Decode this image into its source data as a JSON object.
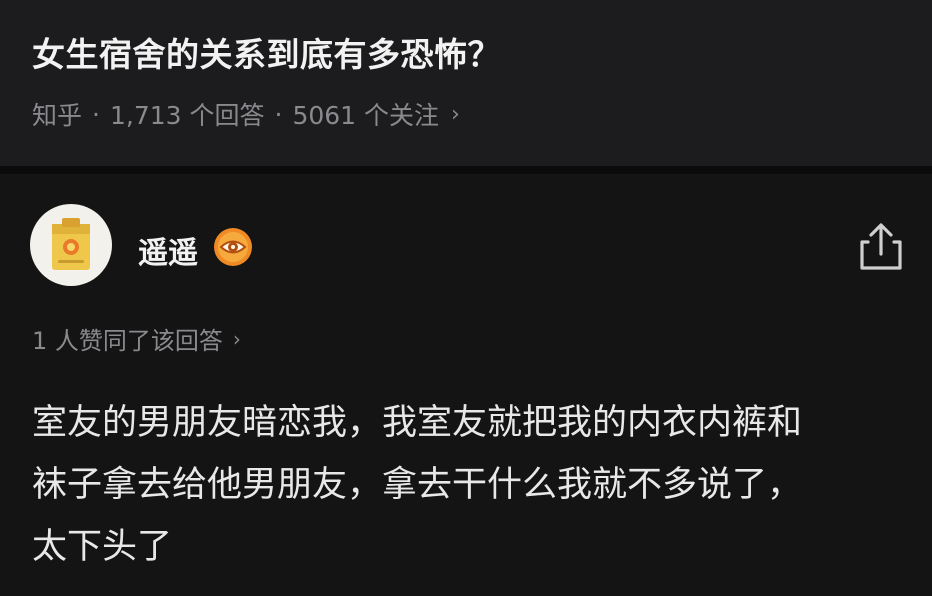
{
  "question": {
    "title": "女生宿舍的关系到底有多恐怖？",
    "source": "知乎",
    "answers_count": "1,713 个回答",
    "followers_count": "5061 个关注",
    "separator": "·",
    "chevron": "›"
  },
  "answer": {
    "author": {
      "name": "遥遥",
      "avatar_icon": "sticky-note-avatar",
      "badge_icon": "eye-badge-icon"
    },
    "share_icon": "share-icon",
    "upvote_text": "1 人赞同了该回答",
    "chevron": "›",
    "content_lines": [
      "室友的男朋友暗恋我，我室友就把我的内衣内裤和",
      "袜子拿去给他男朋友，拿去干什么我就不多说了，",
      "太下头了"
    ]
  },
  "colors": {
    "background": "#121212",
    "question_bg": "#1c1c1e",
    "primary_text": "#f2f2f2",
    "secondary_text": "#8a8a8e",
    "badge_orange": "#f08a24"
  }
}
